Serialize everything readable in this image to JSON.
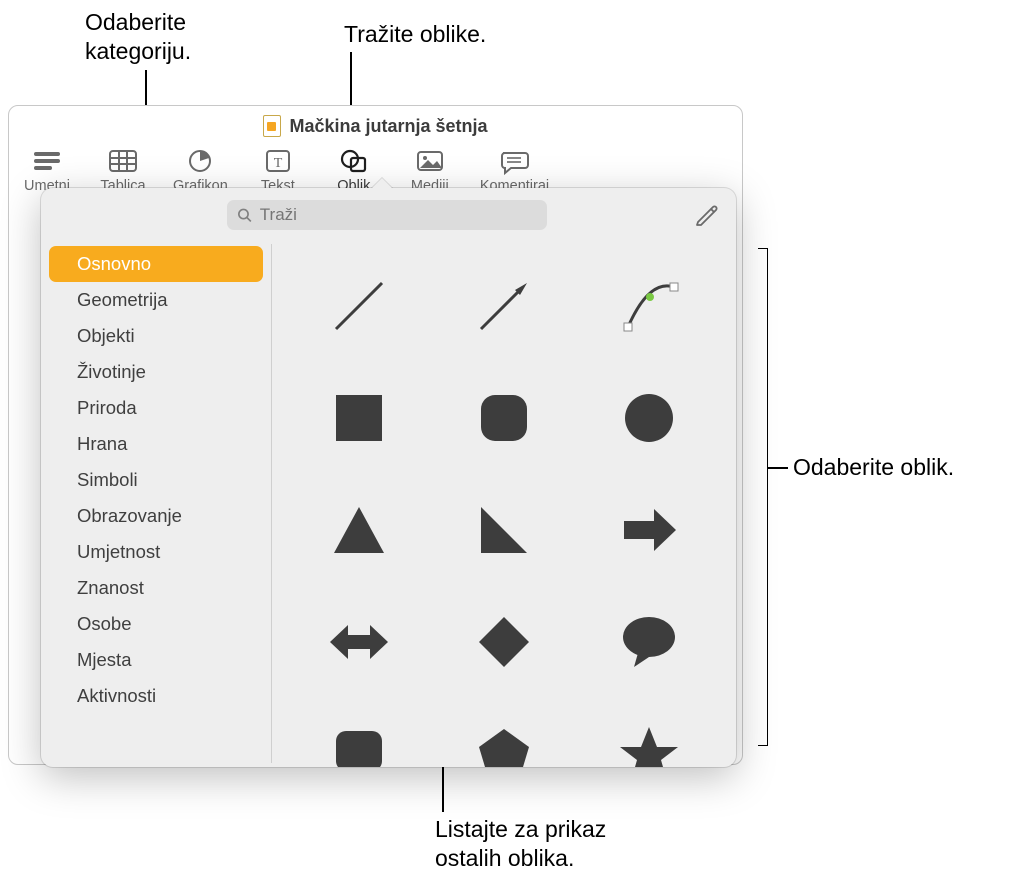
{
  "callouts": {
    "category": "Odaberite\nkategoriju.",
    "search": "Tražite oblike.",
    "select_shape": "Odaberite oblik.",
    "scroll": "Listajte za prikaz\nostalih oblika."
  },
  "window": {
    "title": "Mačkina jutarnja šetnja"
  },
  "toolbar": {
    "insert": "Umetni",
    "table": "Tablica",
    "chart": "Grafikon",
    "text": "Tekst",
    "shape": "Oblik",
    "media": "Mediji",
    "comment": "Komentiraj"
  },
  "search": {
    "placeholder": "Traži"
  },
  "categories": [
    "Osnovno",
    "Geometrija",
    "Objekti",
    "Životinje",
    "Priroda",
    "Hrana",
    "Simboli",
    "Obrazovanje",
    "Umjetnost",
    "Znanost",
    "Osobe",
    "Mjesta",
    "Aktivnosti"
  ],
  "selected_category_index": 0,
  "shapes": [
    "line",
    "arrow-line",
    "curve",
    "square",
    "rounded-square",
    "circle",
    "triangle",
    "right-triangle",
    "arrow-right",
    "double-arrow",
    "diamond",
    "speech-bubble",
    "callout-rect",
    "pentagon",
    "star"
  ]
}
